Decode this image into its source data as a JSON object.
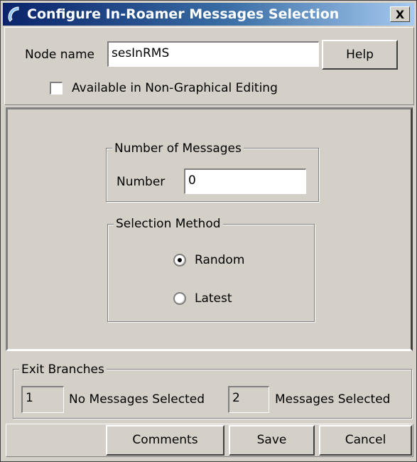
{
  "window": {
    "title": "Configure In-Roamer Messages Selection",
    "close_glyph": "X"
  },
  "node": {
    "label": "Node name",
    "value": "sesInRMS",
    "help_label": "Help",
    "checkbox_label": "Available in Non-Graphical Editing",
    "checkbox_checked": false
  },
  "messages_group": {
    "title": "Number of Messages",
    "number_label": "Number",
    "number_value": "0"
  },
  "selection_group": {
    "title": "Selection Method",
    "options": [
      {
        "label": "Random",
        "selected": true
      },
      {
        "label": "Latest",
        "selected": false
      }
    ]
  },
  "exit_branches": {
    "title": "Exit Branches",
    "branch1_value": "1",
    "branch1_label": "No Messages Selected",
    "branch2_value": "2",
    "branch2_label": "Messages Selected"
  },
  "buttons": {
    "comments": "Comments",
    "save": "Save",
    "cancel": "Cancel"
  }
}
